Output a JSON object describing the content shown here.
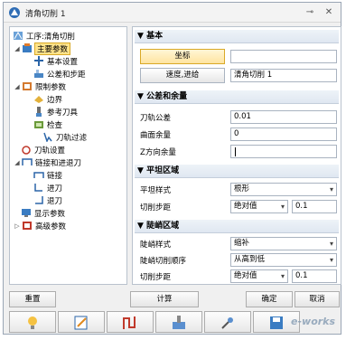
{
  "window": {
    "title": "清角切削 1"
  },
  "tree": {
    "items": [
      {
        "label": "工序:清角切削",
        "icon": "operation-icon"
      },
      {
        "label": "主要参数",
        "icon": "main-params-icon"
      },
      {
        "label": "基本设置",
        "icon": "basic-settings-icon"
      },
      {
        "label": "公差和步距",
        "icon": "tolerance-icon"
      },
      {
        "label": "限制参数",
        "icon": "limit-params-icon"
      },
      {
        "label": "边界",
        "icon": "boundary-icon"
      },
      {
        "label": "参考刀具",
        "icon": "reference-tool-icon"
      },
      {
        "label": "检查",
        "icon": "check-icon"
      },
      {
        "label": "刀轨过滤",
        "icon": "toolpath-filter-icon"
      },
      {
        "label": "刀轨设置",
        "icon": "toolpath-settings-icon"
      },
      {
        "label": "链接和进退刀",
        "icon": "link-icon"
      },
      {
        "label": "链接",
        "icon": "link-sub-icon"
      },
      {
        "label": "进刀",
        "icon": "lead-in-icon"
      },
      {
        "label": "退刀",
        "icon": "lead-out-icon"
      },
      {
        "label": "显示参数",
        "icon": "display-params-icon"
      },
      {
        "label": "高级参数",
        "icon": "advanced-params-icon"
      }
    ]
  },
  "basic": {
    "header": "基本",
    "coord_button": "坐标",
    "coord_value": "",
    "feed_button": "速度,进给",
    "feed_value": "清角切削 1"
  },
  "tolerance": {
    "header": "公差和余量",
    "rows": [
      {
        "label": "刀轨公差",
        "value": "0.01"
      },
      {
        "label": "曲面余量",
        "value": "0"
      },
      {
        "label": "Z方向余量",
        "value": ""
      }
    ]
  },
  "flat": {
    "header": "平坦区域",
    "style_label": "平坦样式",
    "style_value": "根形",
    "step_label": "切削步距",
    "step_mode": "绝对值",
    "step_value": "0.1"
  },
  "steep": {
    "header": "陡峭区域",
    "style_label": "陡峭样式",
    "style_value": "缩补",
    "order_label": "陡峭切削顺序",
    "order_value": "从高到低",
    "step_label": "切削步距",
    "step_mode": "绝对值",
    "step_value": "0.1"
  },
  "bottom": {
    "reset": "重置",
    "calculate": "计算",
    "ok": "确定",
    "cancel": "取消"
  },
  "icon_buttons": [
    "lightbulb-icon",
    "edit-note-icon",
    "toolpath-icon",
    "simulate-icon",
    "tools-icon",
    "save-icon"
  ],
  "watermark": "e-works",
  "colors": {
    "selection": "#ffe38a",
    "section_header": "#dfe7f1",
    "border": "#a9b3c0"
  }
}
